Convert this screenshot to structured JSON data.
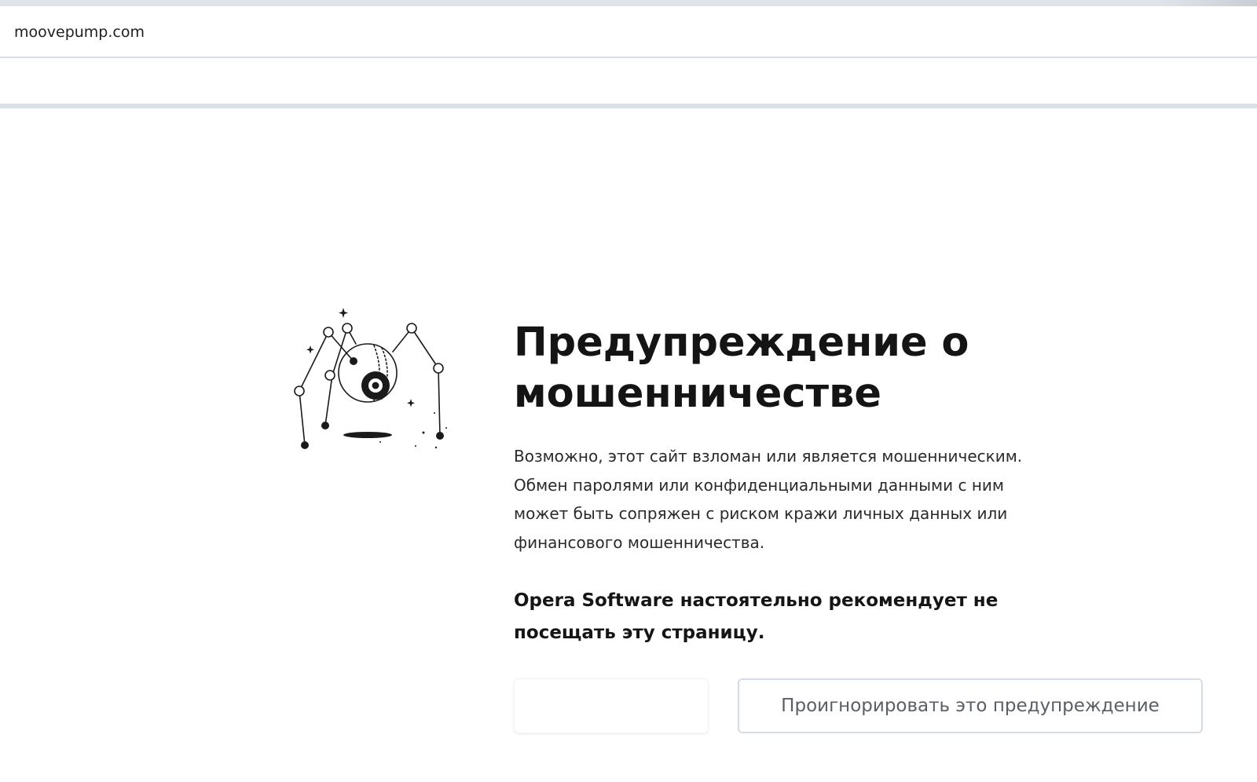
{
  "browser": {
    "url": "moovepump.com"
  },
  "warning": {
    "title_line1": "Предупреждение о",
    "title_line2": "мошенничестве",
    "description_lines": [
      "Возможно, этот сайт взломан или является мошенническим.",
      "Обмен паролями или конфиденциальными данными с ним",
      "может быть сопряжен с риском кражи личных данных или",
      "финансового мошенничества."
    ],
    "recommendation_lines": [
      "Opera Software настоятельно рекомендует не",
      "посещать эту страницу."
    ],
    "back_button_label": "",
    "ignore_button_label": "Проигнорировать это предупреждение"
  },
  "illustration": {
    "icon": "spider-robot-illustration"
  },
  "colors": {
    "text": "#141414",
    "divider": "#d9e1e8",
    "button_border": "#d6dce3",
    "button_text": "#5a5f66"
  }
}
